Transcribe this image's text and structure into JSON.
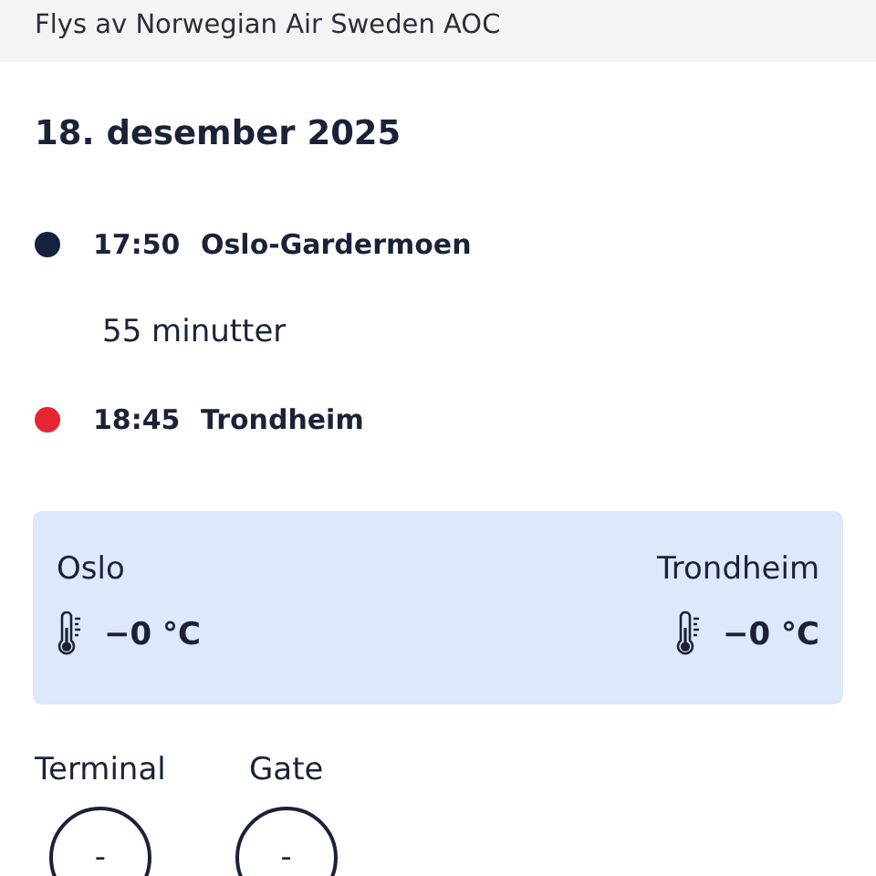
{
  "operator_bar": {
    "text": "Flys av Norwegian Air Sweden AOC"
  },
  "date": "18. desember 2025",
  "timeline": [
    {
      "kind": "stop",
      "time": "17:50",
      "place": "Oslo-Gardermoen",
      "color": "#15213f"
    },
    {
      "kind": "duration",
      "text": "55 minutter"
    },
    {
      "kind": "stop",
      "time": "18:45",
      "place": "Trondheim",
      "color": "#e3262f"
    }
  ],
  "weather": [
    {
      "city": "Oslo",
      "temperature": "−0 °C"
    },
    {
      "city": "Trondheim",
      "temperature": "−0 °C"
    }
  ],
  "info": [
    {
      "label": "Terminal",
      "value": "-"
    },
    {
      "label": "Gate",
      "value": "-"
    }
  ]
}
